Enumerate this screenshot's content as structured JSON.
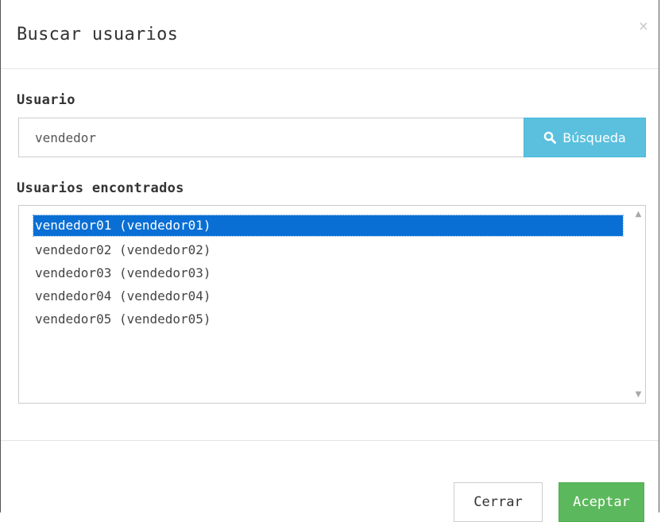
{
  "dialog": {
    "title": "Buscar usuarios",
    "close_symbol": "×",
    "close_icon": "close-icon"
  },
  "search": {
    "label": "Usuario",
    "value": "vendedor",
    "button_label": "Búsqueda",
    "button_icon": "search-icon",
    "button_color": "#5bc0de"
  },
  "results": {
    "label": "Usuarios encontrados",
    "selected_color": "#0a6fd4",
    "items": [
      {
        "text": "vendedor01 (vendedor01)",
        "selected": true
      },
      {
        "text": "vendedor02 (vendedor02)",
        "selected": false
      },
      {
        "text": "vendedor03 (vendedor03)",
        "selected": false
      },
      {
        "text": "vendedor04 (vendedor04)",
        "selected": false
      },
      {
        "text": "vendedor05 (vendedor05)",
        "selected": false
      }
    ],
    "scroll_up_symbol": "▲",
    "scroll_down_symbol": "▼"
  },
  "footer": {
    "close_label": "Cerrar",
    "accept_label": "Aceptar",
    "accept_color": "#5cb85c"
  }
}
